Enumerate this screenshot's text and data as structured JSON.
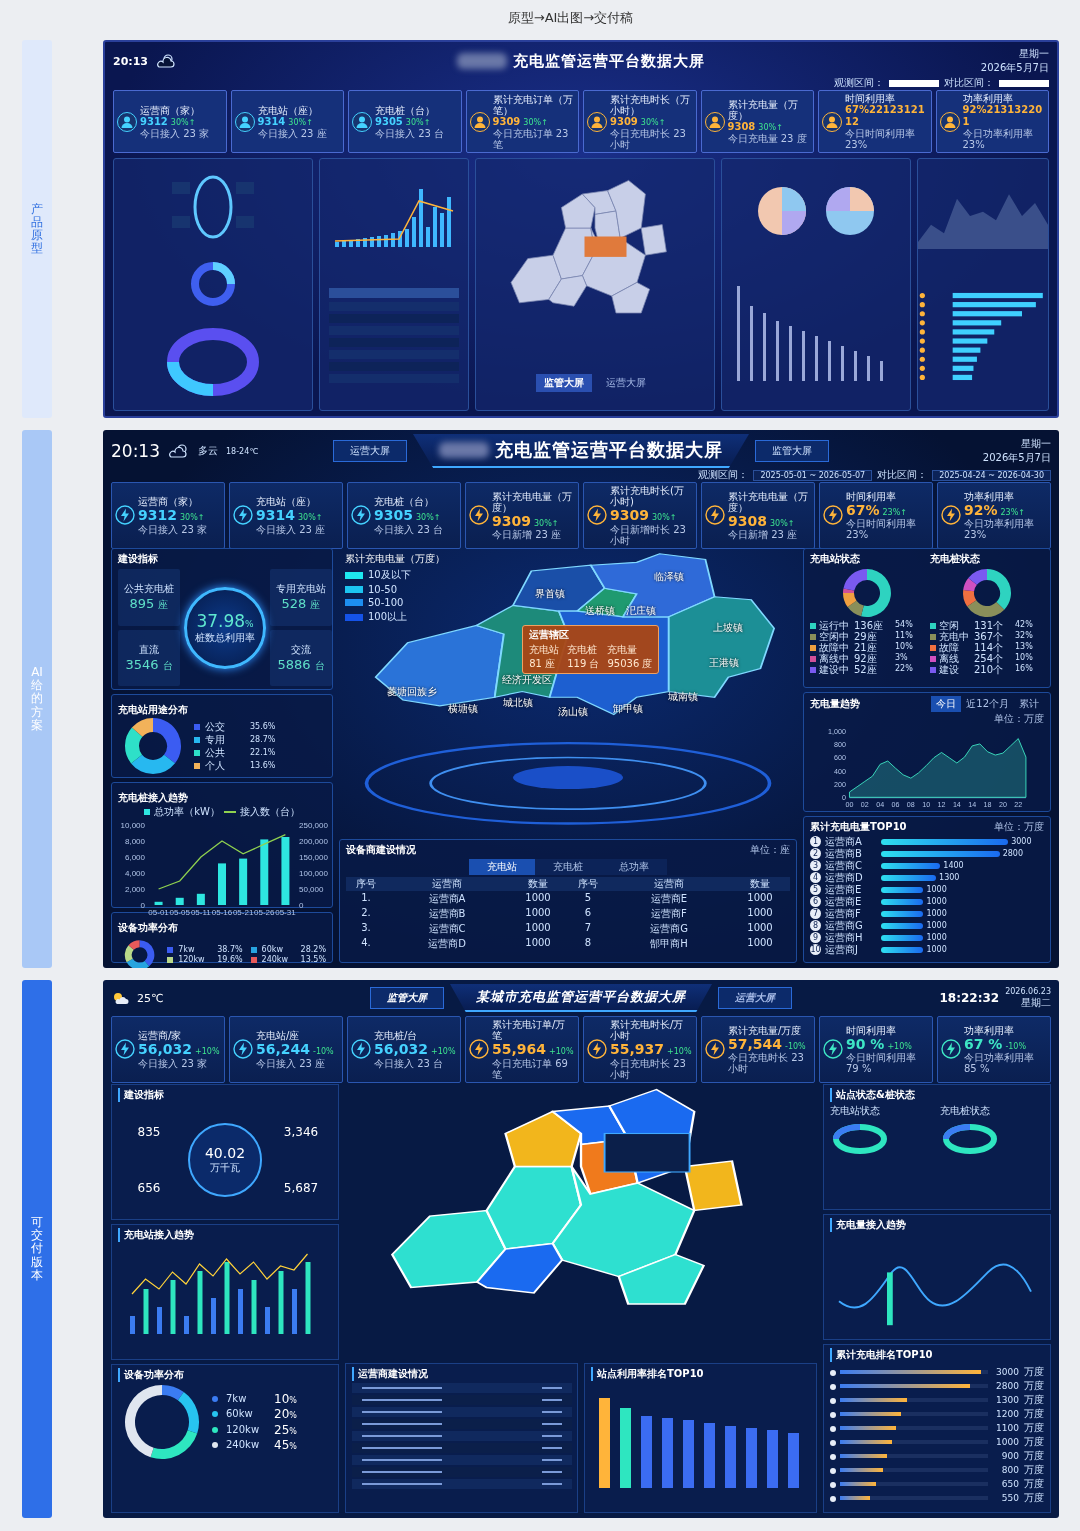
{
  "page_title": "原型→AI出图→交付稿",
  "prototype": {
    "label": "产品原型",
    "header": {
      "time": "20:13",
      "title": "充电监管运营平台数据大屏",
      "weekday": "星期一",
      "date": "2026年5月7日"
    },
    "filters": [
      "观测区间：",
      "对比区间："
    ],
    "kpis": [
      {
        "name": "运营商（家）",
        "value": "9312",
        "change": "30%↑",
        "sub": "今日接入 23 家",
        "color": "#45d2ff"
      },
      {
        "name": "充电站（座）",
        "value": "9314",
        "change": "30%↑",
        "sub": "今日接入 23 座",
        "color": "#45d2ff"
      },
      {
        "name": "充电桩（台）",
        "value": "9305",
        "change": "30%↑",
        "sub": "今日接入 23 台",
        "color": "#45d2ff"
      },
      {
        "name": "累计充电订单（万笔）",
        "value": "9309",
        "change": "30%↑",
        "sub": "今日充电订单 23 笔",
        "color": "#ffb43a"
      },
      {
        "name": "累计充电时长（万小时）",
        "value": "9309",
        "change": "30%↑",
        "sub": "今日充电时长 23 小时",
        "color": "#ffb43a"
      },
      {
        "name": "累计充电量（万度）",
        "value": "9308",
        "change": "30%↑",
        "sub": "今日充电量 23 度",
        "color": "#ffb43a"
      },
      {
        "name": "时间利用率",
        "value": "67%2212312112",
        "sub": "今日时间利用率 23%",
        "color": "#ffb43a"
      },
      {
        "name": "功率利用率",
        "value": "92%213132201",
        "sub": "今日功率利用率 23%",
        "color": "#ffb43a"
      }
    ],
    "map_tabs": [
      {
        "label": "监管大屏",
        "selected": true
      },
      {
        "label": "运营大屏",
        "selected": false
      }
    ]
  },
  "ai_proposal": {
    "label": "AI给的方案",
    "header": {
      "time": "20:13",
      "weather": "多云",
      "temperature": "18-24℃",
      "nav": [
        "运营大屏",
        "监管大屏"
      ],
      "title": "充电监管运营平台数据大屏",
      "weekday": "星期一",
      "date": "2026年5月7日"
    },
    "filters": [
      {
        "label": "观测区间：",
        "value": "2025-05-01 ~ 2026-05-07"
      },
      {
        "label": "对比区间：",
        "value": "2025-04-24 ~ 2026-04-30"
      }
    ],
    "kpis": [
      {
        "name": "运营商（家）",
        "value": "9312",
        "change": "30%↑",
        "sub": "今日接入 23 家",
        "color": "#45d2ff"
      },
      {
        "name": "充电站（座）",
        "value": "9314",
        "change": "30%↑",
        "sub": "今日接入 23 座",
        "color": "#45d2ff"
      },
      {
        "name": "充电桩（台）",
        "value": "9305",
        "change": "30%↑",
        "sub": "今日接入 23 台",
        "color": "#45d2ff"
      },
      {
        "name": "累计充电电量（万度）",
        "value": "9309",
        "change": "30%↑",
        "sub": "今日新增 23 座",
        "color": "#ffb43a"
      },
      {
        "name": "累计充电时长(万小时)",
        "value": "9309",
        "change": "30%↑",
        "sub": "今日新增时长 23 小时",
        "color": "#ffb43a"
      },
      {
        "name": "累计充电电量（万度）",
        "value": "9308",
        "change": "30%↑",
        "sub": "今日新增 23 座",
        "color": "#ffb43a"
      },
      {
        "name": "时间利用率",
        "value": "67%",
        "change": "23%↑",
        "sub": "今日时间利用率 23%",
        "color": "#ffb43a"
      },
      {
        "name": "功率利用率",
        "value": "92%",
        "change": "23%↑",
        "sub": "今日功率利用率 23%",
        "color": "#ffb43a"
      }
    ],
    "construction": {
      "title": "建设指标",
      "rate": "37.98",
      "rate_unit": "%",
      "rate_label": "桩数总利用率",
      "items": [
        {
          "name": "公共充电桩",
          "value": "895",
          "unit": "座"
        },
        {
          "name": "专用充电站",
          "value": "528",
          "unit": "座"
        },
        {
          "name": "直流",
          "value": "3546",
          "unit": "台"
        },
        {
          "name": "交流",
          "value": "5886",
          "unit": "台"
        }
      ]
    },
    "usage": {
      "title": "充电站用途分布",
      "legend": [
        {
          "value": "35.6%",
          "color": "#3b5cf2"
        },
        {
          "value": "28.7%",
          "color": "#27b8f0"
        },
        {
          "value": "22.1%",
          "color": "#2ee0c8"
        },
        {
          "value": "13.6%",
          "color": "#f2b25a"
        }
      ],
      "chart_data": {
        "type": "donut",
        "categories": [
          "公交",
          "专用",
          "公共",
          "个人"
        ],
        "values": [
          35.6,
          28.7,
          22.1,
          13.6
        ]
      }
    },
    "pile_trend": {
      "title": "充电桩接入趋势",
      "power_chart": {
        "chart_data": {
          "type": "bar",
          "categories": [
            "05-01",
            "05-05",
            "05-11",
            "05-16",
            "05-21",
            "05-26",
            "05-31"
          ],
          "ylim": [
            0,
            10000
          ],
          "yticks": [
            {
              "value": 0,
              "label": "0"
            },
            {
              "value": 2000,
              "label": "2,000"
            },
            {
              "value": 4000,
              "label": "4,000"
            },
            {
              "value": 6000,
              "label": "6,000"
            },
            {
              "value": 8000,
              "label": "8,000"
            },
            {
              "value": 10000,
              "label": "10,000"
            }
          ],
          "series": [
            {
              "name": "总功率（kW）",
              "color": "#2ee6e0",
              "values": [
                400,
                900,
                1400,
                5200,
                5800,
                8200,
                8500
              ]
            }
          ]
        }
      },
      "count_chart": {
        "chart_data": {
          "type": "line",
          "categories": [
            null,
            null,
            null,
            null,
            null,
            null,
            null
          ],
          "ylim": [
            0,
            250000
          ],
          "yticks": [
            {
              "value": 0,
              "label": "0"
            },
            {
              "value": 50000,
              "label": "50,000"
            },
            {
              "value": 100000,
              "label": "100,000"
            },
            {
              "value": 150000,
              "label": "150,000"
            },
            {
              "value": 200000,
              "label": "200,000"
            },
            {
              "value": 250000,
              "label": "250,000"
            }
          ],
          "series": [
            {
              "name": "接入数（台）",
              "color": "#8fd14f",
              "values": [
                50000,
                75000,
                150000,
                200000,
                160000,
                190000,
                220000
              ]
            }
          ]
        }
      }
    },
    "power": {
      "title": "设备功率分布",
      "legend": [
        {
          "value": "38.7%",
          "color": "#3b5cf2"
        },
        {
          "value": "28.2%",
          "color": "#27a4e0"
        },
        {
          "value": "19.6%",
          "color": "#b9d98a"
        },
        {
          "value": "13.5%",
          "color": "#e85a5a"
        }
      ],
      "chart_data": {
        "type": "donut",
        "categories": [
          "7kw",
          "60kw",
          "120kw",
          "240kw"
        ],
        "values": [
          38.7,
          28.2,
          19.6,
          13.5
        ]
      }
    },
    "map": {
      "legend_title": "累计充电电量（万度）",
      "legend": [
        {
          "label": "10及以下",
          "color": "#1ee8f0"
        },
        {
          "label": "10-50",
          "color": "#1cc4f0"
        },
        {
          "label": "50-100",
          "color": "#1d8ef0"
        },
        {
          "label": "100以上",
          "color": "#1553e8"
        }
      ],
      "towns": [
        "界首镇",
        "送桥镇",
        "临泽镇",
        "汜庄镇",
        "上坡镇",
        "王港镇",
        "经济开发区",
        "菱塘回族乡",
        "横塘镇",
        "城北镇",
        "汤山镇",
        "卸甲镇",
        "城南镇"
      ],
      "tooltip": {
        "title": "运营辖区",
        "items": [
          {
            "label": "充电站",
            "value": "81 座"
          },
          {
            "label": "充电桩",
            "value": "119 台"
          },
          {
            "label": "充电量",
            "value": "95036 度"
          }
        ]
      }
    },
    "vendor_table": {
      "title": "设备商建设情况",
      "unit": "单位：座",
      "tabs": [
        {
          "label": "充电站",
          "selected": true
        },
        {
          "label": "充电桩",
          "selected": false
        },
        {
          "label": "总功率",
          "selected": false
        }
      ],
      "columns": [
        "序号",
        "运营商",
        "数量",
        "序号",
        "运营商",
        "数量"
      ],
      "rows": [
        [
          "1.",
          "运营商A",
          "1000",
          "5",
          "运营商E",
          "1000"
        ],
        [
          "2.",
          "运营商B",
          "1000",
          "6",
          "运营商F",
          "1000"
        ],
        [
          "3.",
          "运营商C",
          "1000",
          "7",
          "运营商G",
          "1000"
        ],
        [
          "4.",
          "运营商D",
          "1000",
          "8",
          "郜甲商H",
          "1000"
        ]
      ]
    },
    "status": [
      {
        "title": "充电站状态",
        "legend": [
          {
            "count": "136座",
            "value": "54%",
            "color": "#2ed3c0"
          },
          {
            "count": "29座",
            "value": "11%",
            "color": "#8a8f5a"
          },
          {
            "count": "21座",
            "value": "10%",
            "color": "#f0a040"
          },
          {
            "count": "92座",
            "value": "3%",
            "color": "#d0509a"
          },
          {
            "count": "52座",
            "value": "22%",
            "color": "#7a5af0"
          }
        ],
        "chart_data": {
          "type": "donut",
          "categories": [
            "运行中",
            "空闲中",
            "故障中",
            "离线中",
            "建设中"
          ],
          "values": [
            54,
            11,
            10,
            3,
            22
          ]
        }
      },
      {
        "title": "充电桩状态",
        "legend": [
          {
            "count": "131个",
            "value": "42%",
            "color": "#2ed3c0"
          },
          {
            "count": "367个",
            "value": "32%",
            "color": "#8a8f5a"
          },
          {
            "count": "114个",
            "value": "13%",
            "color": "#f07040"
          },
          {
            "count": "254个",
            "value": "10%",
            "color": "#d050c0"
          },
          {
            "count": "210个",
            "value": "16%",
            "color": "#7a5af0"
          }
        ],
        "chart_data": {
          "type": "donut",
          "categories": [
            "空闲",
            "充电中",
            "故障",
            "离线",
            "建设"
          ],
          "values": [
            37.2,
            28.3,
            11.5,
            8.8,
            14.2
          ]
        }
      }
    ],
    "energy_trend": {
      "title": "充电量趋势",
      "unit": "单位：万度",
      "tabs": [
        {
          "label": "今日",
          "selected": true
        },
        {
          "label": "近12个月",
          "selected": false
        },
        {
          "label": "累计",
          "selected": false
        }
      ],
      "chart_data": {
        "type": "area",
        "categories": [
          "00",
          null,
          "02",
          null,
          "04",
          null,
          "06",
          null,
          "08",
          null,
          "10",
          null,
          "12",
          null,
          "14",
          null,
          "14",
          null,
          "18",
          null,
          "20",
          null,
          "22",
          null
        ],
        "ylim": [
          0,
          1000
        ],
        "yticks": [
          {
            "value": 0,
            "label": "0"
          },
          {
            "value": 200,
            "label": "200"
          },
          {
            "value": 400,
            "label": "400"
          },
          {
            "value": 600,
            "label": "600"
          },
          {
            "value": 800,
            "label": "800"
          },
          {
            "value": 1000,
            "label": "1,000"
          }
        ],
        "series": [
          {
            "color": "#3ee6c5",
            "values": [
              80,
              160,
              240,
              320,
              500,
              550,
              440,
              340,
              290,
              370,
              480,
              600,
              680,
              600,
              520,
              610,
              780,
              810,
              690,
              640,
              670,
              780,
              890,
              610
            ]
          }
        ]
      }
    },
    "top10": {
      "title": "累计充电电量TOP10",
      "unit": "单位：万度",
      "chart_data": {
        "type": "bar",
        "orientation": "horizontal",
        "data_labels": true,
        "categories": [
          "运营商A",
          "运营商B",
          "运营商C",
          "运营商D",
          "运营商E",
          "运营商E",
          "运营商F",
          "运营商G",
          "运营商H",
          "运营商J"
        ],
        "values": [
          3000,
          2800,
          1400,
          1300,
          1000,
          1000,
          1000,
          1000,
          1000,
          1000
        ]
      },
      "ranks": [
        "1",
        "2",
        "3",
        "4",
        "5",
        "6",
        "7",
        "8",
        "9",
        "10"
      ]
    }
  },
  "deliverable": {
    "label": "可交付版本",
    "header": {
      "temperature": "25℃",
      "nav": [
        "监管大屏",
        "运营大屏"
      ],
      "title": "某城市充电监管运营平台数据大屏",
      "time": "18:22:32",
      "date": "2026.06.23",
      "weekday": "星期二"
    },
    "kpis": [
      {
        "name": "运营商/家",
        "value": "56,032",
        "change": "+10%",
        "sub": "今日接入 23 家",
        "color": "#45d2ff"
      },
      {
        "name": "充电站/座",
        "value": "56,244",
        "change": "-10%",
        "sub": "今日接入 23 座",
        "color": "#45d2ff"
      },
      {
        "name": "充电桩/台",
        "value": "56,032",
        "change": "+10%",
        "sub": "今日接入 23 台",
        "color": "#45d2ff"
      },
      {
        "name": "累计充电订单/万笔",
        "value": "55,964",
        "change": "+10%",
        "sub": "今日充电订单 69 笔",
        "color": "#ffb43a"
      },
      {
        "name": "累计充电时长/万小时",
        "value": "55,937",
        "change": "+10%",
        "sub": "今日充电时长 23 小时",
        "color": "#ffb43a"
      },
      {
        "name": "累计充电量/万度",
        "value": "57,544",
        "change": "-10%",
        "sub": "今日充电时长 23 小时",
        "color": "#ffb43a"
      },
      {
        "name": "时间利用率",
        "value": "90 %",
        "change": "+10%",
        "sub": "今日时间利用率 79 %",
        "color": "#3ee6c5"
      },
      {
        "name": "功率利用率",
        "value": "67 %",
        "change": "-10%",
        "sub": "今日功率利用率 85 %",
        "color": "#3ee6c5"
      }
    ],
    "construction": {
      "title": "建设指标",
      "center_value": "40.02",
      "center_unit": "万千瓦",
      "values": [
        "835",
        "3,346",
        "656",
        "5,687"
      ]
    },
    "panels": [
      "充电站接入趋势",
      "设备功率分布",
      "运营商建设情况",
      "站点利用率排名TOP10",
      "站点状态&桩状态",
      "充电量接入趋势",
      "累计充电排名TOP10"
    ],
    "status_titles": [
      "充电站状态",
      "充电桩状态"
    ],
    "power": {
      "legend": [
        {
          "value": "10",
          "color": "#3b7cf2"
        },
        {
          "value": "20",
          "color": "#27c4f0"
        },
        {
          "value": "25",
          "color": "#2ee6c0"
        },
        {
          "value": "45",
          "color": "#e0e6f0"
        }
      ],
      "unit": "%",
      "chart_data": {
        "type": "donut",
        "categories": [
          "7kw",
          "60kw",
          "120kw",
          "240kw"
        ],
        "values": [
          10,
          20,
          25,
          45
        ]
      }
    },
    "top10": {
      "rows": [
        {
          "value": "3000",
          "unit": "万度",
          "level": 0.95
        },
        {
          "value": "2800",
          "unit": "万度",
          "level": 0.88
        },
        {
          "value": "1300",
          "unit": "万度",
          "level": 0.45
        },
        {
          "value": "1200",
          "unit": "万度",
          "level": 0.41
        },
        {
          "value": "1100",
          "unit": "万度",
          "level": 0.38
        },
        {
          "value": "1000",
          "unit": "万度",
          "level": 0.35
        },
        {
          "value": "900",
          "unit": "万度",
          "level": 0.32
        },
        {
          "value": "800",
          "unit": "万度",
          "level": 0.29
        },
        {
          "value": "650",
          "unit": "万度",
          "level": 0.24
        },
        {
          "value": "550",
          "unit": "万度",
          "level": 0.2
        }
      ]
    }
  }
}
